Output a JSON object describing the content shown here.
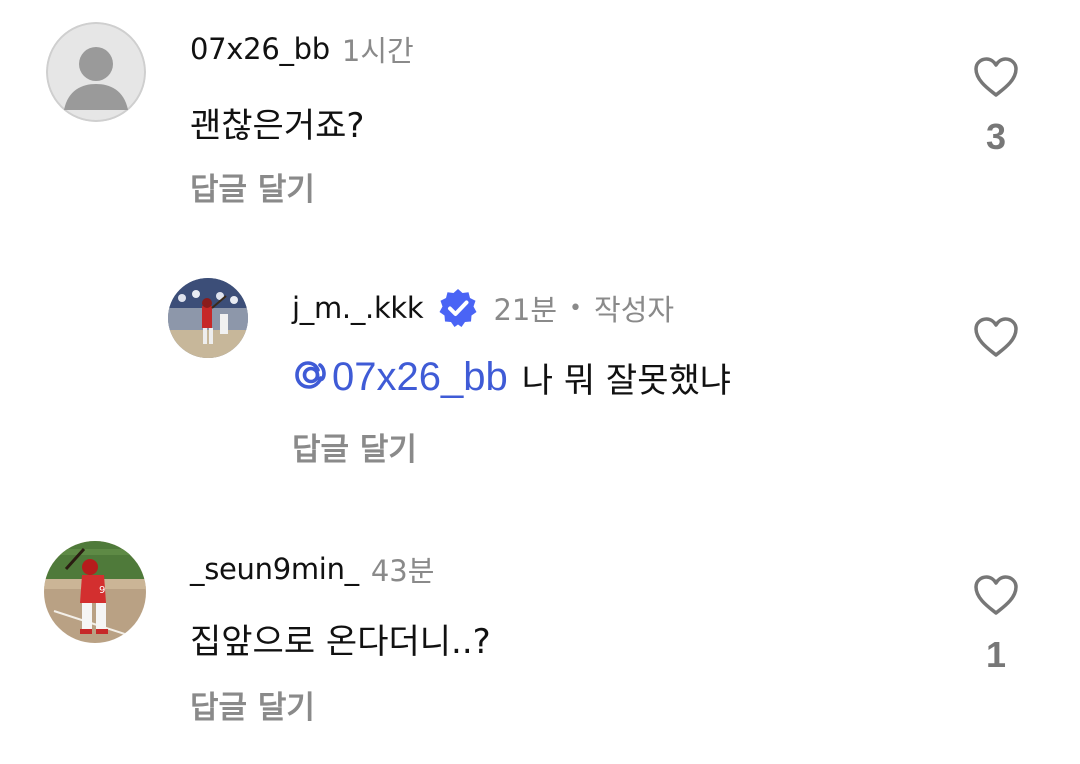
{
  "comments": [
    {
      "username": "07x26_bb",
      "time": "1시간",
      "text": "괜찮은거죠?",
      "reply_label": "답글 달기",
      "likes": "3",
      "avatar": "default-avatar"
    },
    {
      "username": "j_m._.kkk",
      "verified": true,
      "time": "21분",
      "separator": "•",
      "author_badge": "작성자",
      "mention": "@07x26_bb",
      "text": "나 뭐 잘못했냐",
      "reply_label": "답글 달기",
      "likes": "",
      "avatar": "baseball-player-photo"
    },
    {
      "username": "_seun9min_",
      "time": "43분",
      "text": "집앞으로 온다더니..?",
      "reply_label": "답글 달기",
      "likes": "1",
      "avatar": "baseball-batter-photo"
    }
  ],
  "colors": {
    "mention": "#3f5bd6",
    "verified": "#4a64f5",
    "secondary_text": "#8a8a8a"
  }
}
